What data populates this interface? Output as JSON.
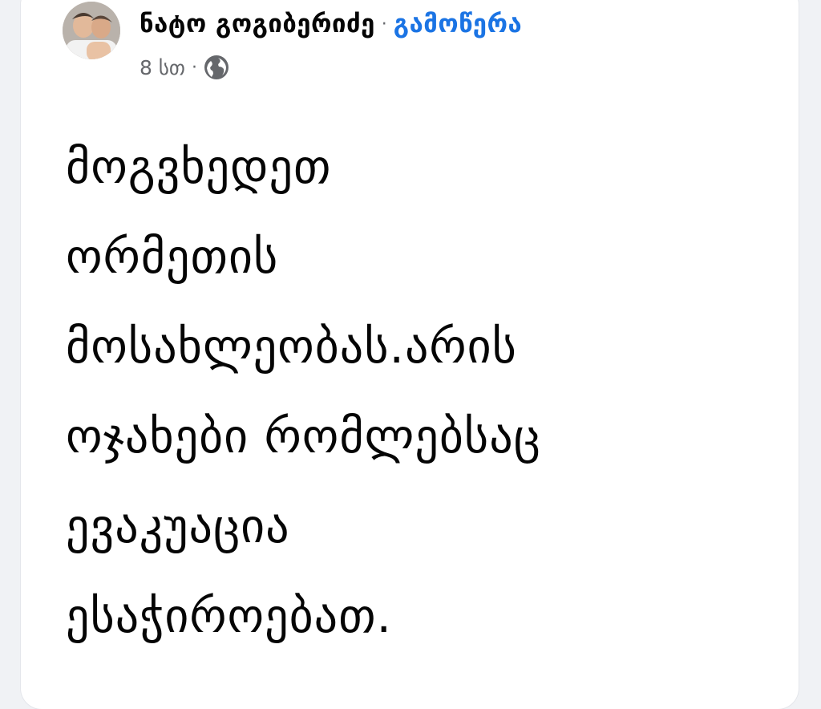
{
  "post": {
    "author": "ნატო გოგიბერიძე",
    "separator": "·",
    "follow_label": "გამოწერა",
    "timestamp": "8 სთ",
    "meta_separator": "·",
    "audience_icon": "globe-icon",
    "lines": [
      "მოგვხედეთ",
      "ორმეთის",
      "მოსახლეობას.არის",
      "ოჯახები რომლებსაც",
      "ევაკუაცია",
      "ესაჭიროებათ."
    ]
  },
  "colors": {
    "accent": "#1b74e4",
    "text": "#050505",
    "muted": "#65676b",
    "background": "#f0f2f5",
    "card": "#ffffff"
  }
}
